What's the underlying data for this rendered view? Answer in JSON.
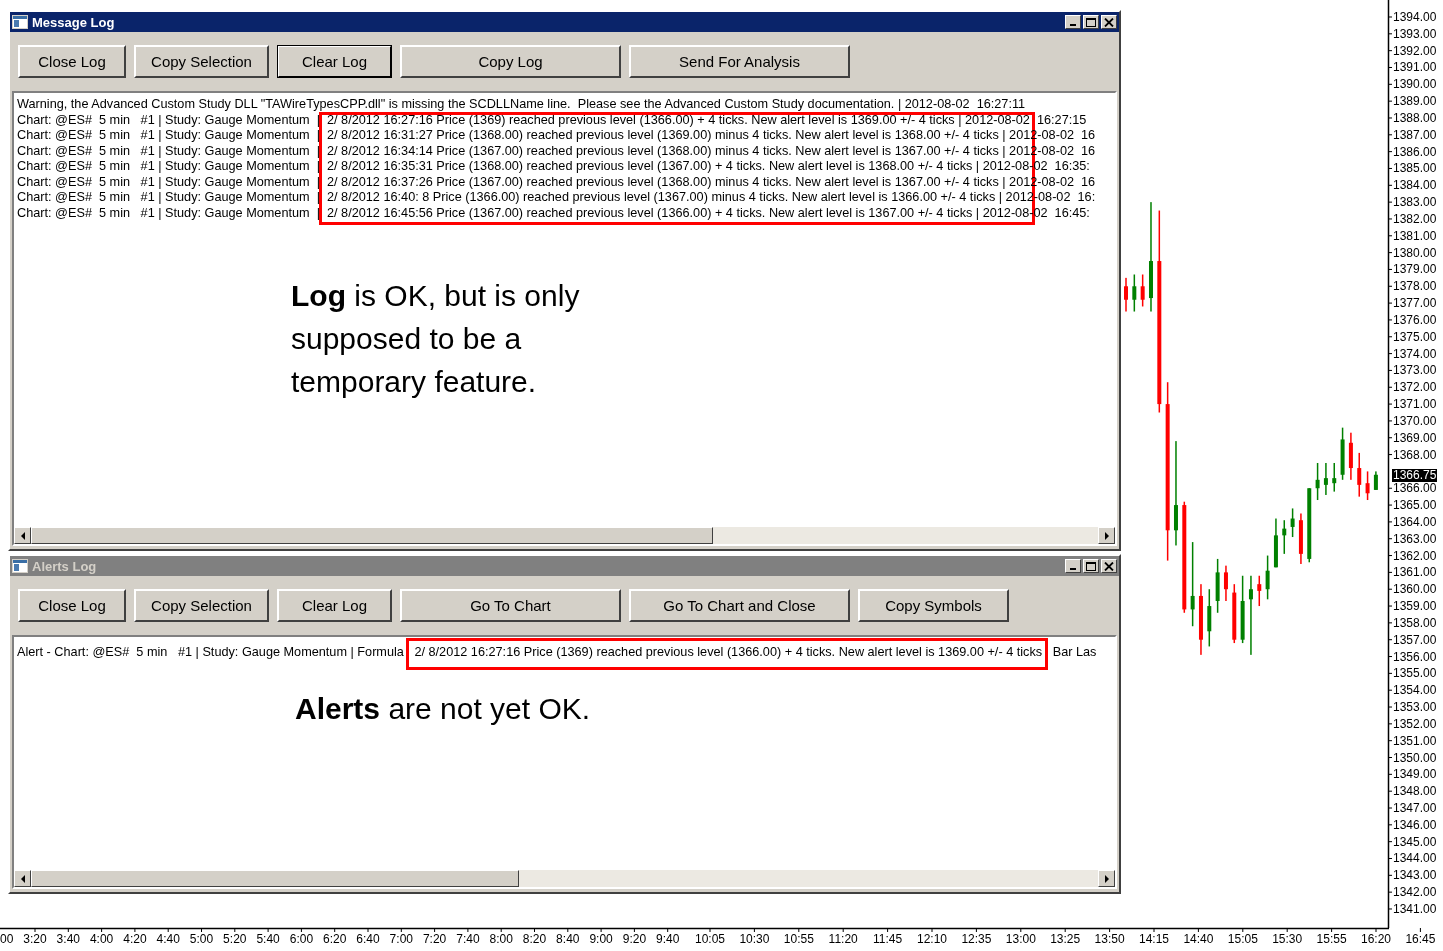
{
  "price_axis": {
    "current_price": "1366.75"
  },
  "chart": {
    "chart_data": {
      "type": "candlestick",
      "ylim": [
        1339.87,
        1395.01
      ],
      "yticks": [
        {
          "value": 1394,
          "label": "1394.00"
        },
        {
          "value": 1393,
          "label": "1393.00"
        },
        {
          "value": 1392,
          "label": "1392.00"
        },
        {
          "value": 1391,
          "label": "1391.00"
        },
        {
          "value": 1390,
          "label": "1390.00"
        },
        {
          "value": 1389,
          "label": "1389.00"
        },
        {
          "value": 1388,
          "label": "1388.00"
        },
        {
          "value": 1387,
          "label": "1387.00"
        },
        {
          "value": 1386,
          "label": "1386.00"
        },
        {
          "value": 1385,
          "label": "1385.00"
        },
        {
          "value": 1384,
          "label": "1384.00"
        },
        {
          "value": 1383,
          "label": "1383.00"
        },
        {
          "value": 1382,
          "label": "1382.00"
        },
        {
          "value": 1381,
          "label": "1381.00"
        },
        {
          "value": 1380,
          "label": "1380.00"
        },
        {
          "value": 1379,
          "label": "1379.00"
        },
        {
          "value": 1378,
          "label": "1378.00"
        },
        {
          "value": 1377,
          "label": "1377.00"
        },
        {
          "value": 1376,
          "label": "1376.00"
        },
        {
          "value": 1375,
          "label": "1375.00"
        },
        {
          "value": 1374,
          "label": "1374.00"
        },
        {
          "value": 1373,
          "label": "1373.00"
        },
        {
          "value": 1372,
          "label": "1372.00"
        },
        {
          "value": 1371,
          "label": "1371.00"
        },
        {
          "value": 1370,
          "label": "1370.00"
        },
        {
          "value": 1369,
          "label": "1369.00"
        },
        {
          "value": 1368,
          "label": "1368.00"
        },
        {
          "value": 1366,
          "label": "1366.00"
        },
        {
          "value": 1365,
          "label": "1365.00"
        },
        {
          "value": 1364,
          "label": "1364.00"
        },
        {
          "value": 1363,
          "label": "1363.00"
        },
        {
          "value": 1362,
          "label": "1362.00"
        },
        {
          "value": 1361,
          "label": "1361.00"
        },
        {
          "value": 1360,
          "label": "1360.00"
        },
        {
          "value": 1359,
          "label": "1359.00"
        },
        {
          "value": 1358,
          "label": "1358.00"
        },
        {
          "value": 1357,
          "label": "1357.00"
        },
        {
          "value": 1356,
          "label": "1356.00"
        },
        {
          "value": 1355,
          "label": "1355.00"
        },
        {
          "value": 1354,
          "label": "1354.00"
        },
        {
          "value": 1353,
          "label": "1353.00"
        },
        {
          "value": 1352,
          "label": "1352.00"
        },
        {
          "value": 1351,
          "label": "1351.00"
        },
        {
          "value": 1350,
          "label": "1350.00"
        },
        {
          "value": 1349,
          "label": "1349.00"
        },
        {
          "value": 1348,
          "label": "1348.00"
        },
        {
          "value": 1347,
          "label": "1347.00"
        },
        {
          "value": 1346,
          "label": "1346.00"
        },
        {
          "value": 1345,
          "label": "1345.00"
        },
        {
          "value": 1344,
          "label": "1344.00"
        },
        {
          "value": 1343,
          "label": "1343.00"
        },
        {
          "value": 1342,
          "label": "1342.00"
        },
        {
          "value": 1341,
          "label": "1341.00"
        }
      ],
      "categories": [
        null,
        null,
        null,
        null,
        null,
        null,
        null,
        null,
        null,
        null,
        null,
        null,
        null,
        null,
        null,
        null,
        null,
        null,
        null,
        null,
        null,
        null,
        null,
        null,
        null,
        null,
        null,
        null,
        null,
        null,
        null
      ],
      "ohlc": [
        [
          1378,
          1378.5,
          1376.5,
          1377.2
        ],
        [
          1377.2,
          1378.7,
          1376.5,
          1378
        ],
        [
          1378,
          1378.7,
          1376.8,
          1377.2
        ],
        [
          1377.3,
          1383,
          1376.5,
          1379.5
        ],
        [
          1379.5,
          1382.5,
          1370.5,
          1371
        ],
        [
          1371,
          1372.3,
          1361.7,
          1363.5
        ],
        [
          1363.5,
          1368.8,
          1362.6,
          1365
        ],
        [
          1365,
          1365.2,
          1358.6,
          1358.8
        ],
        [
          1358.8,
          1362.8,
          1357.8,
          1359.6
        ],
        [
          1359.6,
          1360.3,
          1356.1,
          1357
        ],
        [
          1357.5,
          1360,
          1356.6,
          1359
        ],
        [
          1359.3,
          1361.8,
          1358.6,
          1361
        ],
        [
          1361,
          1361.4,
          1359.3,
          1360
        ],
        [
          1359.8,
          1360.3,
          1356.8,
          1357
        ],
        [
          1357,
          1360.8,
          1356.8,
          1359.3
        ],
        [
          1359.4,
          1360.8,
          1356.1,
          1360
        ],
        [
          1360.3,
          1360.8,
          1359,
          1359.9
        ],
        [
          1360,
          1362,
          1359.4,
          1361.1
        ],
        [
          1361.3,
          1364.2,
          1361.3,
          1363.2
        ],
        [
          1363.2,
          1364.1,
          1362.1,
          1363.6
        ],
        [
          1363.7,
          1364.8,
          1363.1,
          1364.2
        ],
        [
          1364.1,
          1364.5,
          1361.5,
          1362.1
        ],
        [
          1361.8,
          1366,
          1361.6,
          1366
        ],
        [
          1366,
          1367.5,
          1365.3,
          1366.5
        ],
        [
          1366.2,
          1367.5,
          1365.6,
          1366.6
        ],
        [
          1366.3,
          1367.5,
          1365.8,
          1366.6
        ],
        [
          1366.8,
          1369.6,
          1366.5,
          1368.9
        ],
        [
          1368.7,
          1369.3,
          1366.5,
          1367.2
        ],
        [
          1367.2,
          1368.1,
          1365.5,
          1366.2
        ],
        [
          1366.3,
          1367,
          1365.3,
          1365.7
        ],
        [
          1365.9,
          1367,
          1365.9,
          1366.8
        ]
      ]
    }
  },
  "time_axis": {
    "labels": [
      "00",
      "3:20",
      "3:40",
      "4:00",
      "4:20",
      "4:40",
      "5:00",
      "5:20",
      "5:40",
      "6:00",
      "6:20",
      "6:40",
      "7:00",
      "7:20",
      "7:40",
      "8:00",
      "8:20",
      "8:40",
      "9:00",
      "9:20",
      "9:40",
      "10:05",
      "10:30",
      "10:55",
      "11:20",
      "11:45",
      "12:10",
      "12:35",
      "13:00",
      "13:25",
      "13:50",
      "14:15",
      "14:40",
      "15:05",
      "15:30",
      "15:55",
      "16:20",
      "16:45"
    ]
  },
  "windows": [
    {
      "title": "Message Log",
      "active": true,
      "buttons": [
        {
          "label": "Close Log",
          "focused": false
        },
        {
          "label": "Copy Selection",
          "focused": false
        },
        {
          "label": "Clear Log",
          "focused": true
        },
        {
          "label": "Copy Log",
          "focused": false
        },
        {
          "label": "Send For Analysis",
          "focused": false
        }
      ],
      "lines": [
        "Warning, the Advanced Custom Study DLL \"TAWireTypesCPP.dll\" is missing the SCDLLName line.  Please see the Advanced Custom Study documentation. | 2012-08-02  16:27:11",
        "Chart: @ES#  5 min   #1 | Study: Gauge Momentum  |  2/ 8/2012 16:27:16 Price (1369) reached previous level (1366.00) + 4 ticks. New alert level is 1369.00 +/- 4 ticks | 2012-08-02  16:27:15",
        "Chart: @ES#  5 min   #1 | Study: Gauge Momentum  |  2/ 8/2012 16:31:27 Price (1368.00) reached previous level (1369.00) minus 4 ticks. New alert level is 1368.00 +/- 4 ticks | 2012-08-02  16",
        "Chart: @ES#  5 min   #1 | Study: Gauge Momentum  |  2/ 8/2012 16:34:14 Price (1367.00) reached previous level (1368.00) minus 4 ticks. New alert level is 1367.00 +/- 4 ticks | 2012-08-02  16",
        "Chart: @ES#  5 min   #1 | Study: Gauge Momentum  |  2/ 8/2012 16:35:31 Price (1368.00) reached previous level (1367.00) + 4 ticks. New alert level is 1368.00 +/- 4 ticks | 2012-08-02  16:35:",
        "Chart: @ES#  5 min   #1 | Study: Gauge Momentum  |  2/ 8/2012 16:37:26 Price (1367.00) reached previous level (1368.00) minus 4 ticks. New alert level is 1367.00 +/- 4 ticks | 2012-08-02  16",
        "Chart: @ES#  5 min   #1 | Study: Gauge Momentum  |  2/ 8/2012 16:40: 8 Price (1366.00) reached previous level (1367.00) minus 4 ticks. New alert level is 1366.00 +/- 4 ticks | 2012-08-02  16:",
        "Chart: @ES#  5 min   #1 | Study: Gauge Momentum  |  2/ 8/2012 16:45:56 Price (1367.00) reached previous level (1366.00) + 4 ticks. New alert level is 1367.00 +/- 4 ticks | 2012-08-02  16:45:"
      ],
      "annotation": "**Log** is OK, but is only supposed to be a temporary feature."
    },
    {
      "title": "Alerts Log",
      "active": false,
      "buttons": [
        {
          "label": "Close Log",
          "focused": false
        },
        {
          "label": "Copy Selection",
          "focused": false
        },
        {
          "label": "Clear Log",
          "focused": false
        },
        {
          "label": "Go To Chart",
          "focused": false
        },
        {
          "label": "Go To Chart and Close",
          "focused": false
        },
        {
          "label": "Copy Symbols",
          "focused": false
        }
      ],
      "lines": [
        "Alert - Chart: @ES#  5 min   #1 | Study: Gauge Momentum | Formula   2/ 8/2012 16:27:16 Price (1369) reached previous level (1366.00) + 4 ticks. New alert level is 1369.00 +/- 4 ticks   Bar Las"
      ],
      "annotation": "**Alerts** are not yet OK."
    }
  ]
}
